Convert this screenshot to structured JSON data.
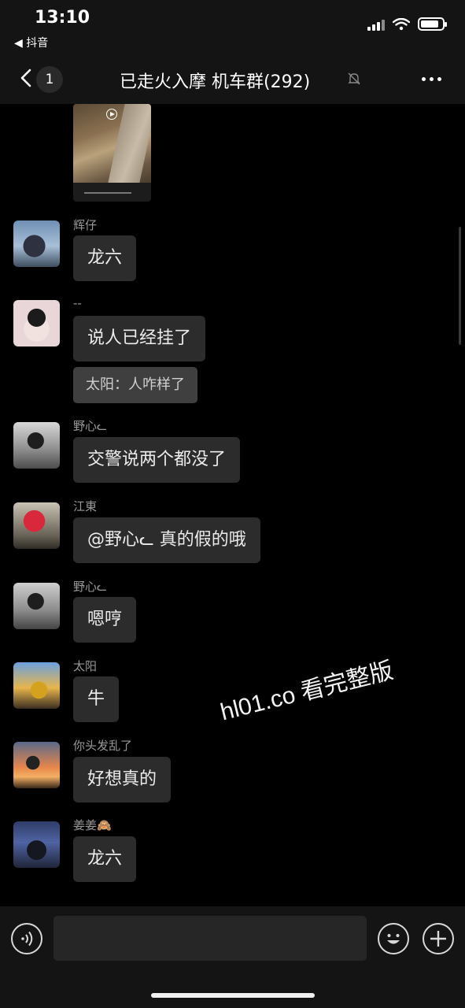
{
  "status_bar": {
    "time": "13:10",
    "back_app": "◀ 抖音"
  },
  "nav": {
    "unread_count": "1",
    "title": "已走火入摩  机车群(292)",
    "muted_icon": "bell-slash-icon",
    "more_icon": "more-dots-icon"
  },
  "messages": [
    {
      "sender": "辉仔",
      "text": "龙六"
    },
    {
      "sender": "--",
      "text": "说人已经挂了",
      "quote": "太阳：人咋样了"
    },
    {
      "sender": "野心ᓚ",
      "text": "交警说两个都没了"
    },
    {
      "sender": "江東",
      "text": "@野心ᓚ 真的假的哦"
    },
    {
      "sender": "野心ᓚ",
      "text": "嗯哼"
    },
    {
      "sender": "太阳",
      "text": "牛"
    },
    {
      "sender": "你头发乱了",
      "text": "好想真的"
    },
    {
      "sender": "姜姜🙈",
      "text": "龙六"
    }
  ],
  "watermark": "hl01.co 看完整版",
  "input_bar": {
    "placeholder": "",
    "voice_icon": "voice-icon",
    "emoji_icon": "emoji-icon",
    "plus_icon": "plus-icon"
  }
}
